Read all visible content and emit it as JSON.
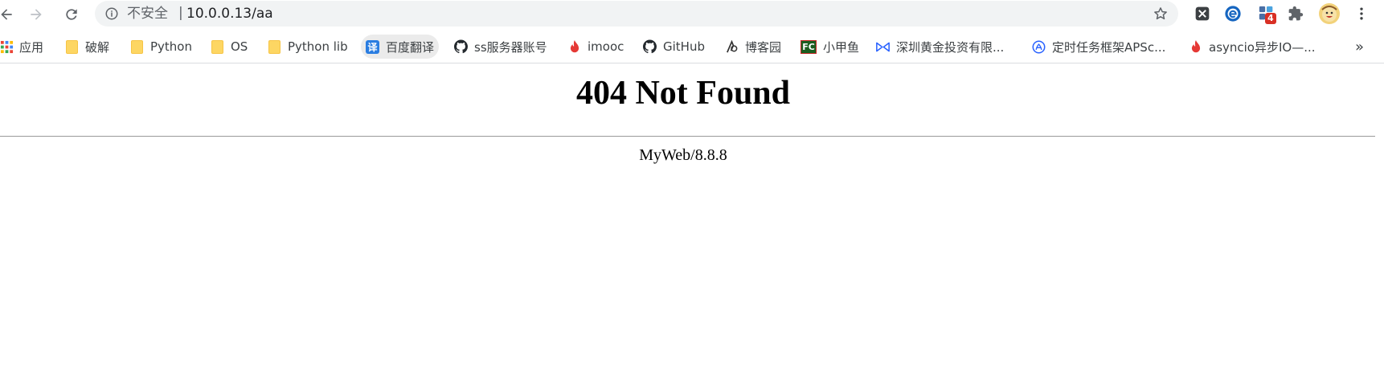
{
  "omnibox": {
    "security_label": "不安全",
    "separator": "|",
    "url": "10.0.0.13/aa"
  },
  "extensions": {
    "badge_count": "4"
  },
  "bookmarks": {
    "items": [
      {
        "label": "应用",
        "icon": "apps-grid-icon"
      },
      {
        "label": "破解",
        "icon": "folder-icon"
      },
      {
        "label": "Python",
        "icon": "folder-icon"
      },
      {
        "label": "OS",
        "icon": "folder-icon"
      },
      {
        "label": "Python lib",
        "icon": "folder-icon"
      },
      {
        "label": "百度翻译",
        "icon": "baidu-translate-icon",
        "icon_text": "译"
      },
      {
        "label": "ss服务器账号",
        "icon": "github-icon"
      },
      {
        "label": "imooc",
        "icon": "flame-icon"
      },
      {
        "label": "GitHub",
        "icon": "github-icon"
      },
      {
        "label": "博客园",
        "icon": "cnblogs-icon"
      },
      {
        "label": "小甲鱼",
        "icon": "fishc-icon",
        "icon_text": "FC"
      },
      {
        "label": "深圳黄金投资有限...",
        "icon": "bowtie-icon"
      },
      {
        "label": "定时任务框架APSc...",
        "icon": "globe-icon"
      },
      {
        "label": "asyncio异步IO—...",
        "icon": "flame-icon"
      }
    ],
    "overflow": "»"
  },
  "page": {
    "title": "404 Not Found",
    "server": "MyWeb/8.8.8"
  },
  "colors": {
    "omnibox_bg": "#f1f3f4",
    "badge_red": "#d93025",
    "accent_blue": "#1a73e8"
  }
}
